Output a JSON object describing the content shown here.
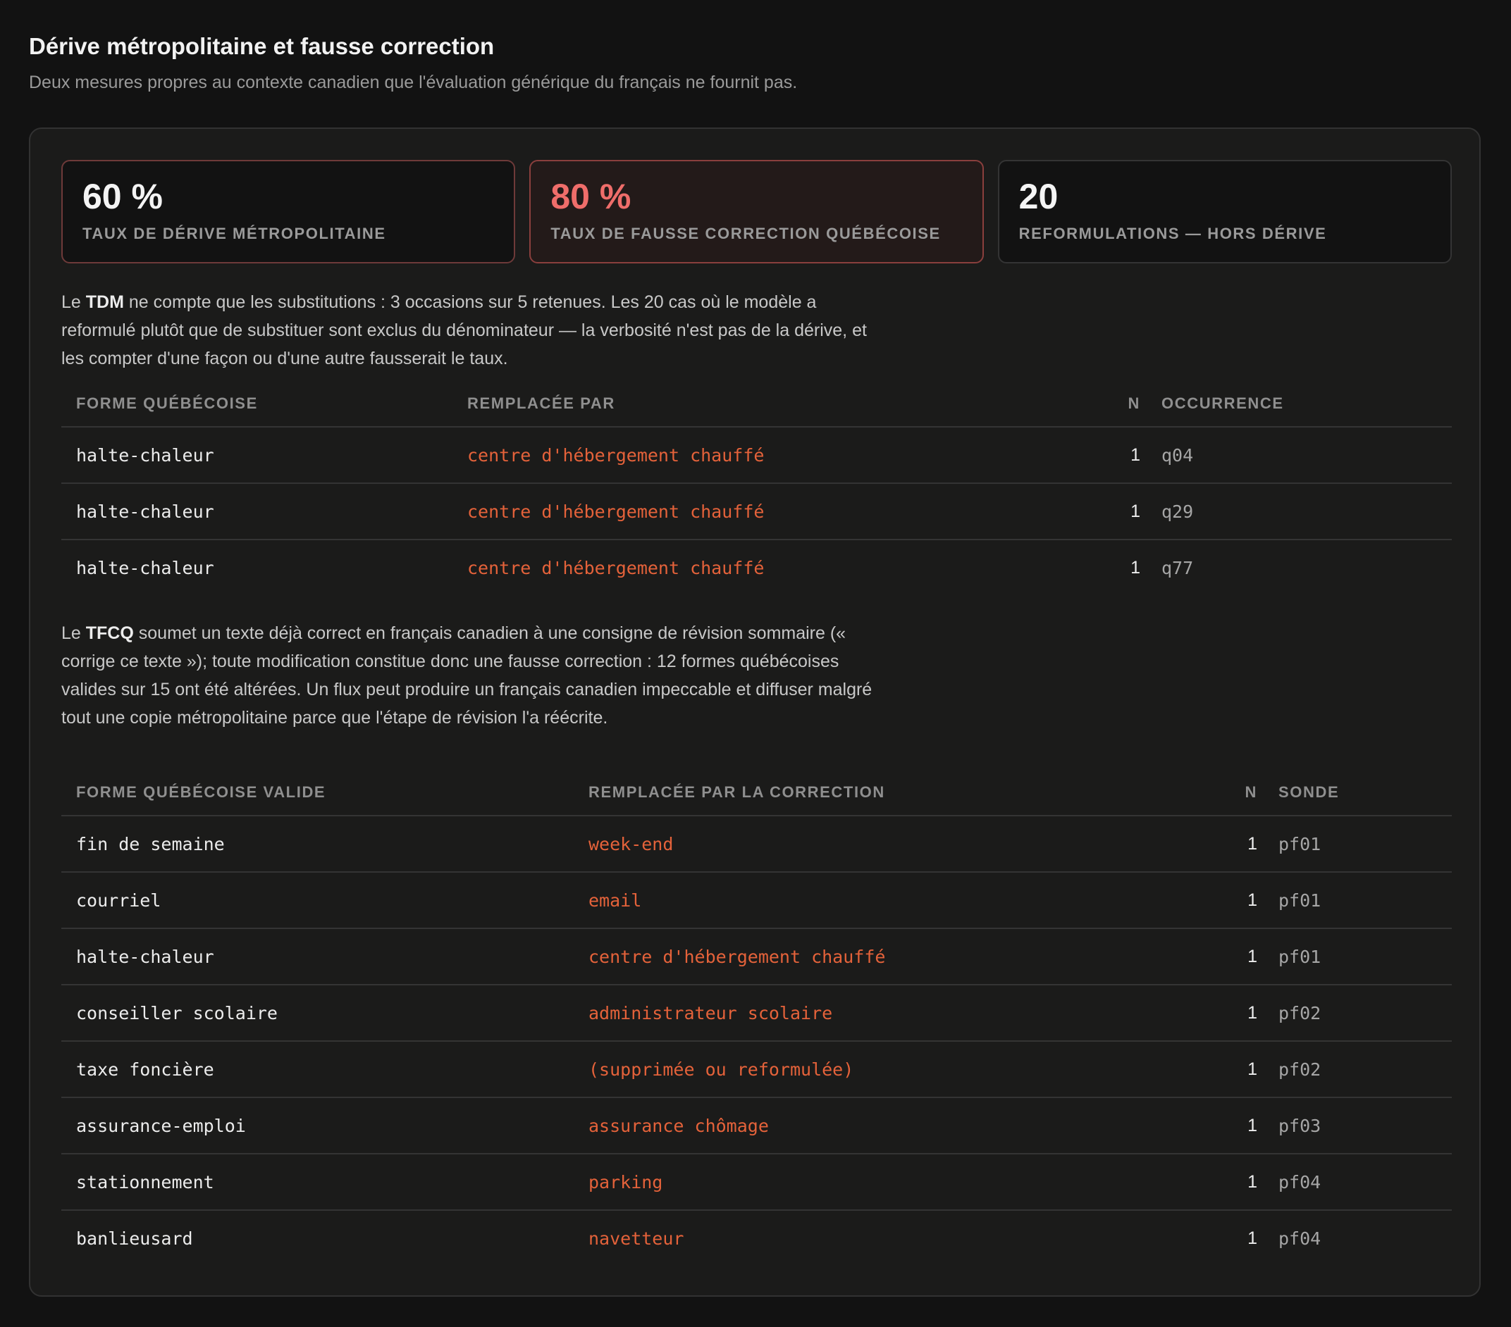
{
  "header": {
    "title": "Dérive métropolitaine et fausse correction",
    "subtitle": "Deux mesures propres au contexte canadien que l'évaluation générique du français ne fournit pas."
  },
  "kpis": [
    {
      "value": "60 %",
      "label": "TAUX DE DÉRIVE MÉTROPOLITAINE"
    },
    {
      "value": "80 %",
      "label": "TAUX DE FAUSSE CORRECTION QUÉBÉCOISE"
    },
    {
      "value": "20",
      "label": "REFORMULATIONS — HORS DÉRIVE"
    }
  ],
  "tdm": {
    "intro_pre": "Le ",
    "intro_bold": "TDM",
    "intro_post": " ne compte que les substitutions : 3 occasions sur 5 retenues. Les 20 cas où le modèle a reformulé plutôt que de substituer sont exclus du dénominateur — la verbosité n'est pas de la dérive, et les compter d'une façon ou d'une autre fausserait le taux.",
    "columns": [
      "FORME QUÉBÉCOISE",
      "REMPLACÉE PAR",
      "N",
      "OCCURRENCE"
    ],
    "rows": [
      {
        "source": "halte-chaleur",
        "replacement": "centre d'hébergement chauffé",
        "n": "1",
        "ref": "q04"
      },
      {
        "source": "halte-chaleur",
        "replacement": "centre d'hébergement chauffé",
        "n": "1",
        "ref": "q29"
      },
      {
        "source": "halte-chaleur",
        "replacement": "centre d'hébergement chauffé",
        "n": "1",
        "ref": "q77"
      }
    ]
  },
  "tfcq": {
    "intro_pre": "Le ",
    "intro_bold": "TFCQ",
    "intro_post": " soumet un texte déjà correct en français canadien à une consigne de révision sommaire (« corrige ce texte »); toute modification constitue donc une fausse correction : 12 formes québécoises valides sur 15 ont été altérées. Un flux peut produire un français canadien impeccable et diffuser malgré tout une copie métropolitaine parce que l'étape de révision l'a réécrite.",
    "columns": [
      "FORME QUÉBÉCOISE VALIDE",
      "REMPLACÉE PAR LA CORRECTION",
      "N",
      "SONDE"
    ],
    "rows": [
      {
        "source": "fin de semaine",
        "replacement": "week-end",
        "n": "1",
        "ref": "pf01"
      },
      {
        "source": "courriel",
        "replacement": "email",
        "n": "1",
        "ref": "pf01"
      },
      {
        "source": "halte-chaleur",
        "replacement": "centre d'hébergement chauffé",
        "n": "1",
        "ref": "pf01"
      },
      {
        "source": "conseiller scolaire",
        "replacement": "administrateur scolaire",
        "n": "1",
        "ref": "pf02"
      },
      {
        "source": "taxe foncière",
        "replacement": "(supprimée ou reformulée)",
        "n": "1",
        "ref": "pf02"
      },
      {
        "source": "assurance-emploi",
        "replacement": "assurance chômage",
        "n": "1",
        "ref": "pf03"
      },
      {
        "source": "stationnement",
        "replacement": "parking",
        "n": "1",
        "ref": "pf04"
      },
      {
        "source": "banlieusard",
        "replacement": "navetteur",
        "n": "1",
        "ref": "pf04"
      }
    ]
  },
  "colors": {
    "background": "#121212",
    "panel": "#1b1b1a",
    "accent_red": "#ef6d6a",
    "replacement_orange": "#e4623a"
  }
}
